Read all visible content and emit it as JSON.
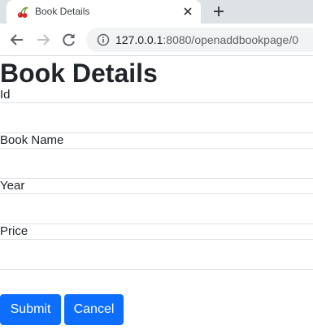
{
  "browser": {
    "tab_title": "Book Details",
    "close_symbol": "✕",
    "new_tab_symbol": "+",
    "url_host": "127.0.0.1",
    "url_path": ":8080/openaddbookpage/0"
  },
  "page": {
    "title": "Book Details",
    "fields": [
      {
        "label": "Id",
        "value": ""
      },
      {
        "label": "Book Name",
        "value": ""
      },
      {
        "label": "Year",
        "value": ""
      },
      {
        "label": "Price",
        "value": ""
      }
    ],
    "submit_label": "Submit",
    "cancel_label": "Cancel"
  },
  "colors": {
    "primary_button": "#0d6efd",
    "tabstrip": "#dee1e6",
    "omnibox": "#f1f3f4"
  },
  "icons": [
    "cherry-favicon-icon",
    "close-icon",
    "plus-icon",
    "back-arrow-icon",
    "forward-arrow-icon",
    "reload-icon",
    "info-icon"
  ]
}
